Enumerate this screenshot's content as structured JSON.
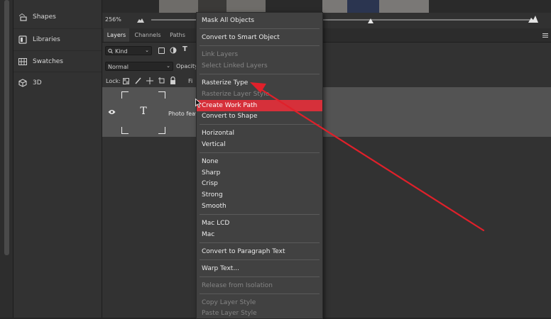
{
  "left_dock": {
    "items": [
      {
        "label": "Shapes",
        "icon": "shapes-icon"
      },
      {
        "label": "Libraries",
        "icon": "libraries-icon"
      },
      {
        "label": "Swatches",
        "icon": "swatches-icon"
      },
      {
        "label": "3D",
        "icon": "3d-cube-icon"
      }
    ]
  },
  "zoom": {
    "level": "256%"
  },
  "layers_panel": {
    "tabs": [
      {
        "label": "Layers",
        "active": true
      },
      {
        "label": "Channels",
        "active": false
      },
      {
        "label": "Paths",
        "active": false
      }
    ],
    "filter_kind": "Kind",
    "blend_mode": "Normal",
    "opacity_label": "Opacity",
    "lock_label": "Lock:",
    "fill_label": "Fi",
    "layer": {
      "name": "Photo feav",
      "type_glyph": "T",
      "visible": true
    }
  },
  "context_menu": {
    "items": [
      {
        "label": "Mask All Objects",
        "disabled": false
      },
      {
        "label": "Convert to Smart Object",
        "disabled": false
      },
      {
        "label": "Link Layers",
        "disabled": true
      },
      {
        "label": "Select Linked Layers",
        "disabled": true
      },
      {
        "label": "Rasterize Type",
        "disabled": false
      },
      {
        "label": "Rasterize Layer Style",
        "disabled": true
      },
      {
        "label": "Create Work Path",
        "disabled": false,
        "highlighted": true
      },
      {
        "label": "Convert to Shape",
        "disabled": false
      },
      {
        "label": "Horizontal",
        "disabled": false
      },
      {
        "label": "Vertical",
        "disabled": false
      },
      {
        "label": "None",
        "disabled": false
      },
      {
        "label": "Sharp",
        "disabled": false
      },
      {
        "label": "Crisp",
        "disabled": false
      },
      {
        "label": "Strong",
        "disabled": false
      },
      {
        "label": "Smooth",
        "disabled": false
      },
      {
        "label": "Mac LCD",
        "disabled": false
      },
      {
        "label": "Mac",
        "disabled": false
      },
      {
        "label": "Convert to Paragraph Text",
        "disabled": false
      },
      {
        "label": "Warp Text...",
        "disabled": false
      },
      {
        "label": "Release from Isolation",
        "disabled": true
      },
      {
        "label": "Copy Layer Style",
        "disabled": true
      },
      {
        "label": "Paste Layer Style",
        "disabled": true
      }
    ]
  },
  "colors": {
    "highlight": "#d6303a",
    "annotation_arrow": "#e0202a",
    "panel_bg": "#323232",
    "menu_bg": "#414141"
  }
}
